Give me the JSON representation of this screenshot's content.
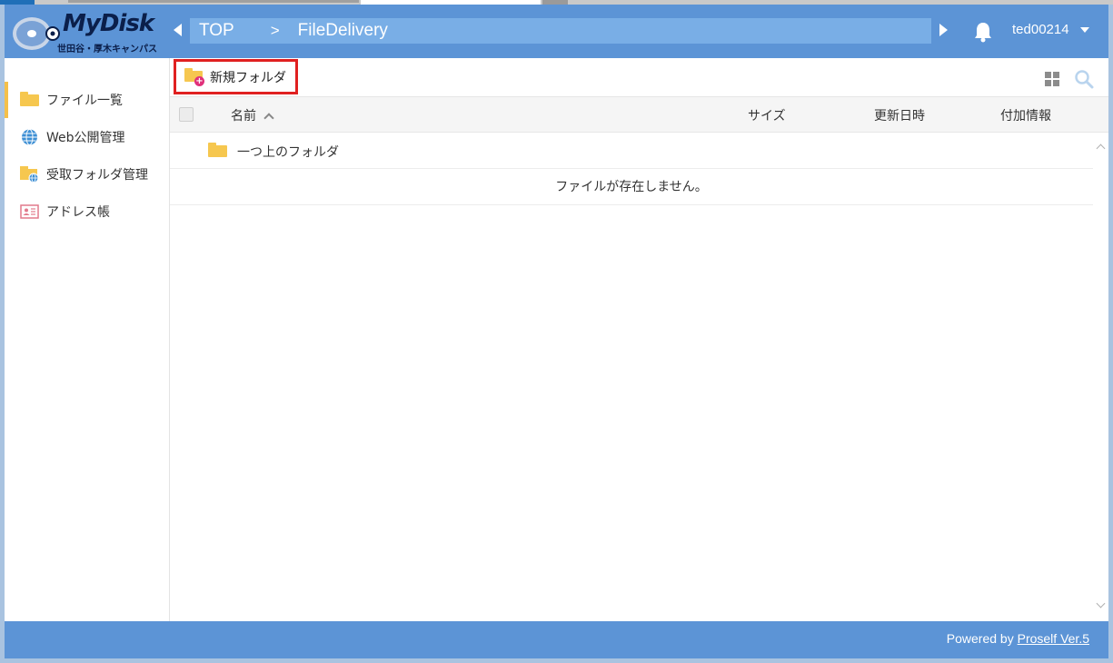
{
  "header": {
    "logo_text": "MyDisk",
    "logo_subtitle": "世田谷・厚木キャンパス",
    "breadcrumb": [
      "TOP",
      "FileDelivery"
    ],
    "breadcrumb_separator": ">",
    "username": "ted00214"
  },
  "sidebar": {
    "items": [
      {
        "label": "ファイル一覧",
        "icon": "folder-icon",
        "active": true
      },
      {
        "label": "Web公開管理",
        "icon": "globe-icon"
      },
      {
        "label": "受取フォルダ管理",
        "icon": "folder-globe-icon"
      },
      {
        "label": "アドレス帳",
        "icon": "address-card-icon"
      }
    ]
  },
  "toolbar": {
    "new_folder_label": "新規フォルダ"
  },
  "table": {
    "columns": {
      "name": "名前",
      "size": "サイズ",
      "updated": "更新日時",
      "info": "付加情報"
    },
    "parent_folder_label": "一つ上のフォルダ",
    "empty_message": "ファイルが存在しません。"
  },
  "footer": {
    "powered_by": "Powered by",
    "link_text": "Proself Ver.5"
  },
  "colors": {
    "header_bg": "#5c94d6",
    "breadcrumb_bg": "#79aee6",
    "folder": "#f6c74f",
    "highlight": "#e02020"
  }
}
